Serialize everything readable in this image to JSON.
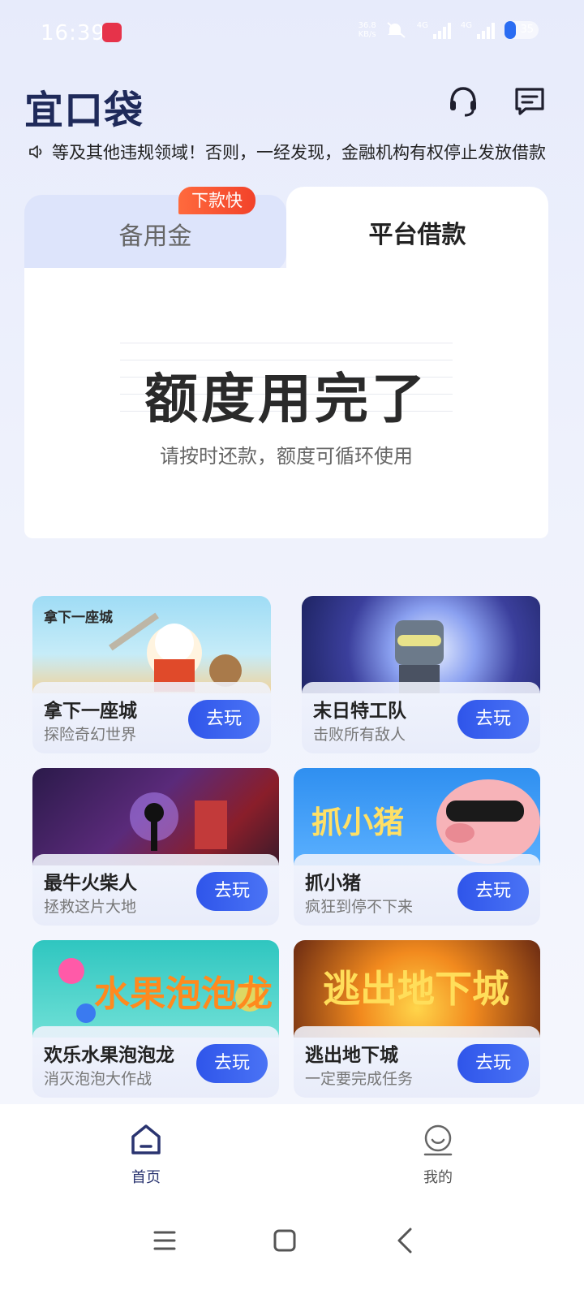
{
  "status_bar": {
    "time": "16:39",
    "net_speed": "36.8",
    "net_speed_unit": "KB/s",
    "signal1_label": "4G",
    "signal2_label": "4G",
    "battery": "35"
  },
  "header": {
    "logo": "宜口袋"
  },
  "notice": {
    "text": "等及其他违规领域！否则，一经发现，金融机构有权停止发放借款"
  },
  "loan": {
    "tab_reserve": "备用金",
    "tab_reserve_badge": "下款快",
    "tab_platform": "平台借款",
    "quota_title": "额度用完了",
    "quota_subtitle": "请按时还款，额度可循环使用"
  },
  "games": [
    {
      "title": "拿下一座城",
      "subtitle": "探险奇幻世界",
      "button": "去玩",
      "art_text": "拿下一座城"
    },
    {
      "title": "末日特工队",
      "subtitle": "击败所有敌人",
      "button": "去玩",
      "art_text": ""
    },
    {
      "title": "最牛火柴人",
      "subtitle": "拯救这片大地",
      "button": "去玩",
      "art_text": ""
    },
    {
      "title": "抓小猪",
      "subtitle": "疯狂到停不下来",
      "button": "去玩",
      "art_text": "抓小猪"
    },
    {
      "title": "欢乐水果泡泡龙",
      "subtitle": "消灭泡泡大作战",
      "button": "去玩",
      "art_text": "水果泡泡龙"
    },
    {
      "title": "逃出地下城",
      "subtitle": "一定要完成任务",
      "button": "去玩",
      "art_text": "逃出地下城"
    }
  ],
  "bottom_nav": {
    "home": "首页",
    "mine": "我的"
  },
  "colors": {
    "accent": "#2f55ea",
    "badge": "#f2422a",
    "logo": "#1f2a5a"
  }
}
